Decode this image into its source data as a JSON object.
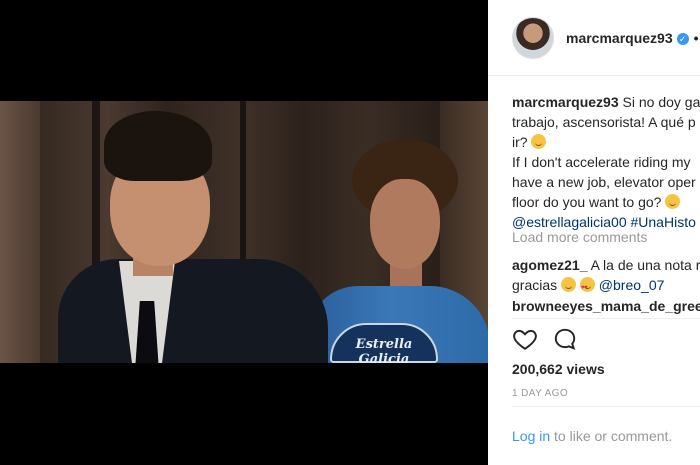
{
  "post": {
    "username": "marcmarquez93",
    "more_dot": "•"
  },
  "caption": {
    "username": "marcmarquez93",
    "line1": " Si no doy ga",
    "line2": "trabajo, ascensorista! A qué p",
    "line3": "ir? ",
    "line4": "If I don't accelerate riding my",
    "line5": "have a new job, elevator oper",
    "line6": "floor do you want to go? ",
    "line7_mention": "@estrellagalicia00",
    "line7_tag": " #UnaHisto"
  },
  "load_more": "Load more comments",
  "comment2": {
    "username": "agomez21_",
    "text": " A la de una nota r",
    "line2a": "gracias ",
    "line2_mention": " @breo_07"
  },
  "comment3": {
    "username": "browneeyes_mama_de_gree"
  },
  "likes": "200,662 views",
  "timestamp": "1 DAY AGO",
  "login": {
    "link": "Log in",
    "rest": " to like or comment."
  },
  "video": {
    "suit_logo_text": "Estrella Galicia"
  },
  "colors": {
    "link_blue": "#3897f0",
    "mention_blue": "#003569",
    "muted": "#999999",
    "text": "#262626"
  },
  "icons": [
    "heart-icon",
    "comment-icon",
    "verified-icon",
    "emoji-smile-icon",
    "emoji-love-icon"
  ]
}
